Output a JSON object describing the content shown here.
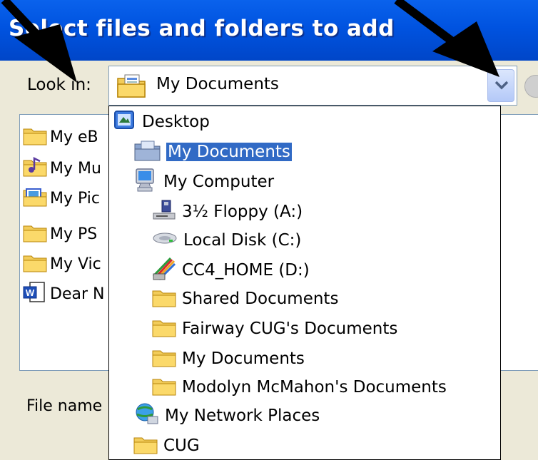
{
  "dialog": {
    "title": "Select files and folders to add"
  },
  "look_in": {
    "label": "Look in:",
    "value": "My Documents",
    "icon": "my-documents-icon"
  },
  "file_list": {
    "items": [
      {
        "label": "My eB",
        "icon": "folder-icon"
      },
      {
        "label": "My Mu",
        "icon": "music-folder-icon"
      },
      {
        "label": "My Pic",
        "icon": "pictures-folder-icon"
      },
      {
        "label": "My PS",
        "icon": "folder-icon"
      },
      {
        "label": "My Vic",
        "icon": "folder-icon"
      },
      {
        "label": "Dear N",
        "icon": "word-document-icon"
      }
    ]
  },
  "file_name": {
    "label": "File name"
  },
  "dropdown": {
    "items": [
      {
        "label": "Desktop",
        "icon": "desktop-icon",
        "selected": false
      },
      {
        "label": "My Documents",
        "icon": "my-documents-icon",
        "selected": true
      },
      {
        "label": "My Computer",
        "icon": "computer-icon",
        "selected": false
      },
      {
        "label": "3½ Floppy (A:)",
        "icon": "floppy-drive-icon",
        "selected": false
      },
      {
        "label": "Local Disk (C:)",
        "icon": "hard-disk-icon",
        "selected": false
      },
      {
        "label": "CC4_HOME (D:)",
        "icon": "network-drive-icon",
        "selected": false
      },
      {
        "label": "Shared Documents",
        "icon": "folder-icon",
        "selected": false
      },
      {
        "label": "Fairway CUG's Documents",
        "icon": "folder-icon",
        "selected": false
      },
      {
        "label": "My Documents",
        "icon": "folder-icon",
        "selected": false
      },
      {
        "label": "Modolyn McMahon's Documents",
        "icon": "folder-icon",
        "selected": false
      },
      {
        "label": "My Network Places",
        "icon": "network-places-icon",
        "selected": false
      },
      {
        "label": "CUG",
        "icon": "folder-icon",
        "selected": false
      }
    ]
  },
  "colors": {
    "title_bar": "#0053e0",
    "selection": "#316ac5",
    "dialog_bg": "#ece9d8",
    "annotation_arrow": "#000000"
  }
}
